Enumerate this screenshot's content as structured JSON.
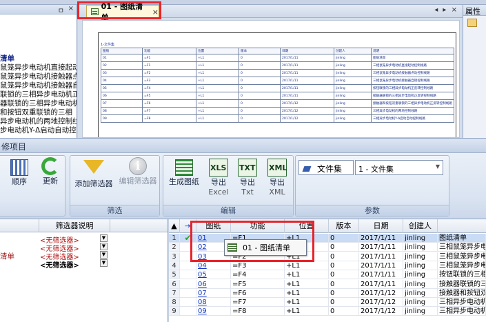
{
  "left_pane": {
    "pin": "ㅁ",
    "close": "×",
    "lines": [
      "清单",
      "鼠笼异步电动机直接起动",
      "鼠笼异步电动机接触器点",
      "鼠笼异步电动机接触器自",
      "联锁的三相异步电动机正",
      "器联锁的三相异步电动机",
      "和按钮双重联锁的三相",
      "异步电动机的两地控制线",
      "步电动机Y-Δ启动自动控"
    ]
  },
  "doc_tab": {
    "label": "01 - 图纸清单",
    "close": "×",
    "arrows": "◂ ▸ ×"
  },
  "sheet": {
    "caption": "1-文件集",
    "headers": [
      "图纸",
      "功能",
      "位置",
      "版本",
      "日期",
      "创建人",
      "说明"
    ],
    "rows": [
      [
        "01",
        "=F1",
        "+L1",
        "0",
        "2017/1/11",
        "jinling",
        "图纸清单"
      ],
      [
        "02",
        "=F1",
        "+L1",
        "0",
        "2017/1/11",
        "jinling",
        "三相鼠笼异步电动机直接起动控制线路"
      ],
      [
        "03",
        "=F2",
        "+L1",
        "0",
        "2017/1/11",
        "jinling",
        "三相鼠笼异步电动机接触器点动控制线路"
      ],
      [
        "04",
        "=F3",
        "+L1",
        "0",
        "2017/1/11",
        "jinling",
        "三相鼠笼异步电动机接触器自锁控制线路"
      ],
      [
        "05",
        "=F4",
        "+L1",
        "0",
        "2017/1/11",
        "jinling",
        "按钮联锁的三相异步电动机正反转控制线路"
      ],
      [
        "06",
        "=F5",
        "+L1",
        "0",
        "2017/1/11",
        "jinling",
        "接触器联锁的三相异步电动机正反转控制线路"
      ],
      [
        "07",
        "=F6",
        "+L1",
        "0",
        "2017/1/12",
        "jinling",
        "接触器和按钮双重联锁的三相异步电动机正反转控制线路"
      ],
      [
        "08",
        "=F7",
        "+L1",
        "0",
        "2017/1/12",
        "jinling",
        "三相异步电动机的两地控制线路"
      ],
      [
        "09",
        "=F8",
        "+L1",
        "0",
        "2017/1/12",
        "jinling",
        "三相异步电动机Y-Δ启动自动控制线路"
      ]
    ]
  },
  "prop_pane": {
    "title": "属性"
  },
  "project_title": "修项目",
  "ribbon": {
    "btn_order": "顺序",
    "btn_refresh": "更新",
    "btn_add_filter": "添加筛选器",
    "btn_edit_filter": "编辑筛选器",
    "group_filter": "筛选",
    "btn_generate": "生成图纸",
    "btn_export_excel": [
      "导出",
      "Excel"
    ],
    "btn_export_txt": [
      "导出",
      "Txt"
    ],
    "btn_export_xml": [
      "导出",
      "XML"
    ],
    "icon_xls": "XLS",
    "icon_txt": "TXT",
    "icon_xml": "XML",
    "group_edit": "编辑",
    "param_combo1": "文件集",
    "param_combo2": "1 - 文件集",
    "group_param": "参数"
  },
  "filter_pane": {
    "header": "筛选器说明",
    "rows": [
      {
        "left": "",
        "value": "<无筛选器>",
        "bold": false
      },
      {
        "left": "",
        "value": "<无筛选器>",
        "bold": false
      },
      {
        "left": "清单",
        "value": "<无筛选器>",
        "bold": false
      },
      {
        "left": "",
        "value": "<无筛选器>",
        "bold": true
      }
    ]
  },
  "grid": {
    "headers": [
      "图纸",
      "功能",
      "位置",
      "版本",
      "日期",
      "创建人"
    ],
    "rows": [
      [
        "1",
        "01",
        "=F1",
        "+L1",
        "0",
        "2017/1/11",
        "jinling",
        "图纸清单"
      ],
      [
        "2",
        "02",
        "=F1",
        "+L1",
        "0",
        "2017/1/11",
        "jinling",
        "三相鼠笼异步电"
      ],
      [
        "3",
        "03",
        "=F2",
        "+L1",
        "0",
        "2017/1/11",
        "jinling",
        "三相鼠笼异步电"
      ],
      [
        "4",
        "04",
        "=F3",
        "+L1",
        "0",
        "2017/1/11",
        "jinling",
        "三相鼠笼异步电"
      ],
      [
        "5",
        "05",
        "=F4",
        "+L1",
        "0",
        "2017/1/11",
        "jinling",
        "按钮联锁的三相"
      ],
      [
        "6",
        "06",
        "=F5",
        "+L1",
        "0",
        "2017/1/11",
        "jinling",
        "接触器联锁的三"
      ],
      [
        "7",
        "07",
        "=F6",
        "+L1",
        "0",
        "2017/1/12",
        "jinling",
        "接触器和按钮双"
      ],
      [
        "8",
        "08",
        "=F7",
        "+L1",
        "0",
        "2017/1/12",
        "jinling",
        "三相异步电动机"
      ],
      [
        "9",
        "09",
        "=F8",
        "+L1",
        "0",
        "2017/1/12",
        "jinling",
        "三相异步电动机"
      ]
    ],
    "popup": "01 - 图纸清单"
  }
}
